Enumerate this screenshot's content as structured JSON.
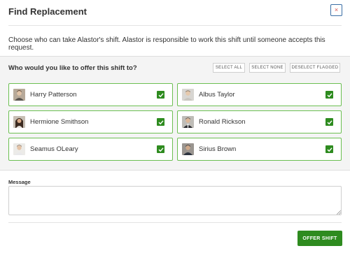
{
  "dialog": {
    "title": "Find Replacement",
    "close_label": "×",
    "description": "Choose who can take Alastor's shift. Alastor is responsible to work this shift until someone accepts this request."
  },
  "offer": {
    "question": "Who would you like to offer this shift to?",
    "select_all": "SELECT ALL",
    "select_none": "SELECT NONE",
    "deselect_flagged": "DESELECT FLAGGED",
    "people": [
      {
        "name": "Harry Patterson",
        "checked": true
      },
      {
        "name": "Albus Taylor",
        "checked": true
      },
      {
        "name": "Hermione Smithson",
        "checked": true
      },
      {
        "name": "Ronald Rickson",
        "checked": true
      },
      {
        "name": "Seamus OLeary",
        "checked": true
      },
      {
        "name": "Sirius Brown",
        "checked": true
      }
    ]
  },
  "message": {
    "label": "Message",
    "value": "",
    "placeholder": ""
  },
  "footer": {
    "offer_button": "OFFER SHIFT"
  },
  "colors": {
    "accent_green": "#2e8b1f",
    "card_border": "#6cbf52",
    "close_border": "#3b6ea5",
    "close_icon": "#d9534f"
  }
}
